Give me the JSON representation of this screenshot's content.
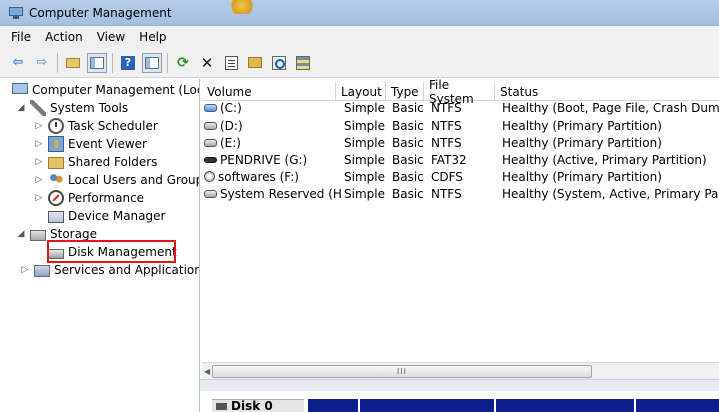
{
  "window": {
    "title": "Computer Management"
  },
  "menu": [
    "File",
    "Action",
    "View",
    "Help"
  ],
  "tree": {
    "root": "Computer Management (Local",
    "system_tools": "System Tools",
    "system_items": [
      "Task Scheduler",
      "Event Viewer",
      "Shared Folders",
      "Local Users and Groups",
      "Performance",
      "Device Manager"
    ],
    "storage": "Storage",
    "disk_management": "Disk Management",
    "services": "Services and Applications"
  },
  "list": {
    "columns": [
      "Volume",
      "Layout",
      "Type",
      "File System",
      "Status"
    ],
    "rows": [
      {
        "volume": "(C:)",
        "layout": "Simple",
        "type": "Basic",
        "fs": "NTFS",
        "status": "Healthy (Boot, Page File, Crash Dump, Pri"
      },
      {
        "volume": "(D:)",
        "layout": "Simple",
        "type": "Basic",
        "fs": "NTFS",
        "status": "Healthy (Primary Partition)"
      },
      {
        "volume": "(E:)",
        "layout": "Simple",
        "type": "Basic",
        "fs": "NTFS",
        "status": "Healthy (Primary Partition)"
      },
      {
        "volume": "PENDRIVE (G:)",
        "layout": "Simple",
        "type": "Basic",
        "fs": "FAT32",
        "status": "Healthy (Active, Primary Partition)"
      },
      {
        "volume": "softwares (F:)",
        "layout": "Simple",
        "type": "Basic",
        "fs": "CDFS",
        "status": "Healthy (Primary Partition)"
      },
      {
        "volume": "System Reserved (H:)",
        "layout": "Simple",
        "type": "Basic",
        "fs": "NTFS",
        "status": "Healthy (System, Active, Primary Partition"
      }
    ]
  },
  "scrollbar": {
    "grip": "III"
  },
  "disk": {
    "label": "Disk 0"
  },
  "colors": {
    "highlight_box": "#e0161e",
    "partition_bar": "#0c1f8a"
  }
}
